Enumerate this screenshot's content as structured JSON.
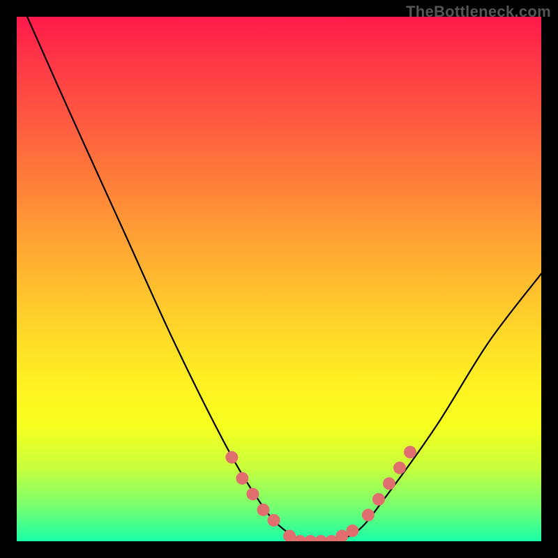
{
  "watermark": "TheBottleneck.com",
  "chart_data": {
    "type": "line",
    "title": "",
    "xlabel": "",
    "ylabel": "",
    "xlim": [
      0,
      100
    ],
    "ylim": [
      0,
      100
    ],
    "grid": false,
    "legend": false,
    "background_gradient": {
      "top": "#ff1a4b",
      "mid": "#ffd829",
      "bottom": "#18ffa8"
    },
    "series": [
      {
        "name": "bottleneck-curve",
        "color": "#000000",
        "x": [
          2,
          10,
          20,
          30,
          40,
          46,
          50,
          55,
          60,
          65,
          70,
          80,
          90,
          100
        ],
        "y": [
          100,
          82,
          60,
          38,
          18,
          8,
          3,
          0,
          0,
          2,
          8,
          22,
          38,
          51
        ]
      }
    ],
    "markers": {
      "name": "highlighted-range",
      "color": "#e06e6e",
      "radius_px": 9,
      "points": [
        {
          "x": 41,
          "y": 16
        },
        {
          "x": 43,
          "y": 12
        },
        {
          "x": 45,
          "y": 9
        },
        {
          "x": 47,
          "y": 6
        },
        {
          "x": 49,
          "y": 4
        },
        {
          "x": 52,
          "y": 1
        },
        {
          "x": 54,
          "y": 0
        },
        {
          "x": 56,
          "y": 0
        },
        {
          "x": 58,
          "y": 0
        },
        {
          "x": 60,
          "y": 0
        },
        {
          "x": 62,
          "y": 1
        },
        {
          "x": 64,
          "y": 2
        },
        {
          "x": 67,
          "y": 5
        },
        {
          "x": 69,
          "y": 8
        },
        {
          "x": 71,
          "y": 11
        },
        {
          "x": 73,
          "y": 14
        },
        {
          "x": 75,
          "y": 17
        }
      ]
    }
  }
}
